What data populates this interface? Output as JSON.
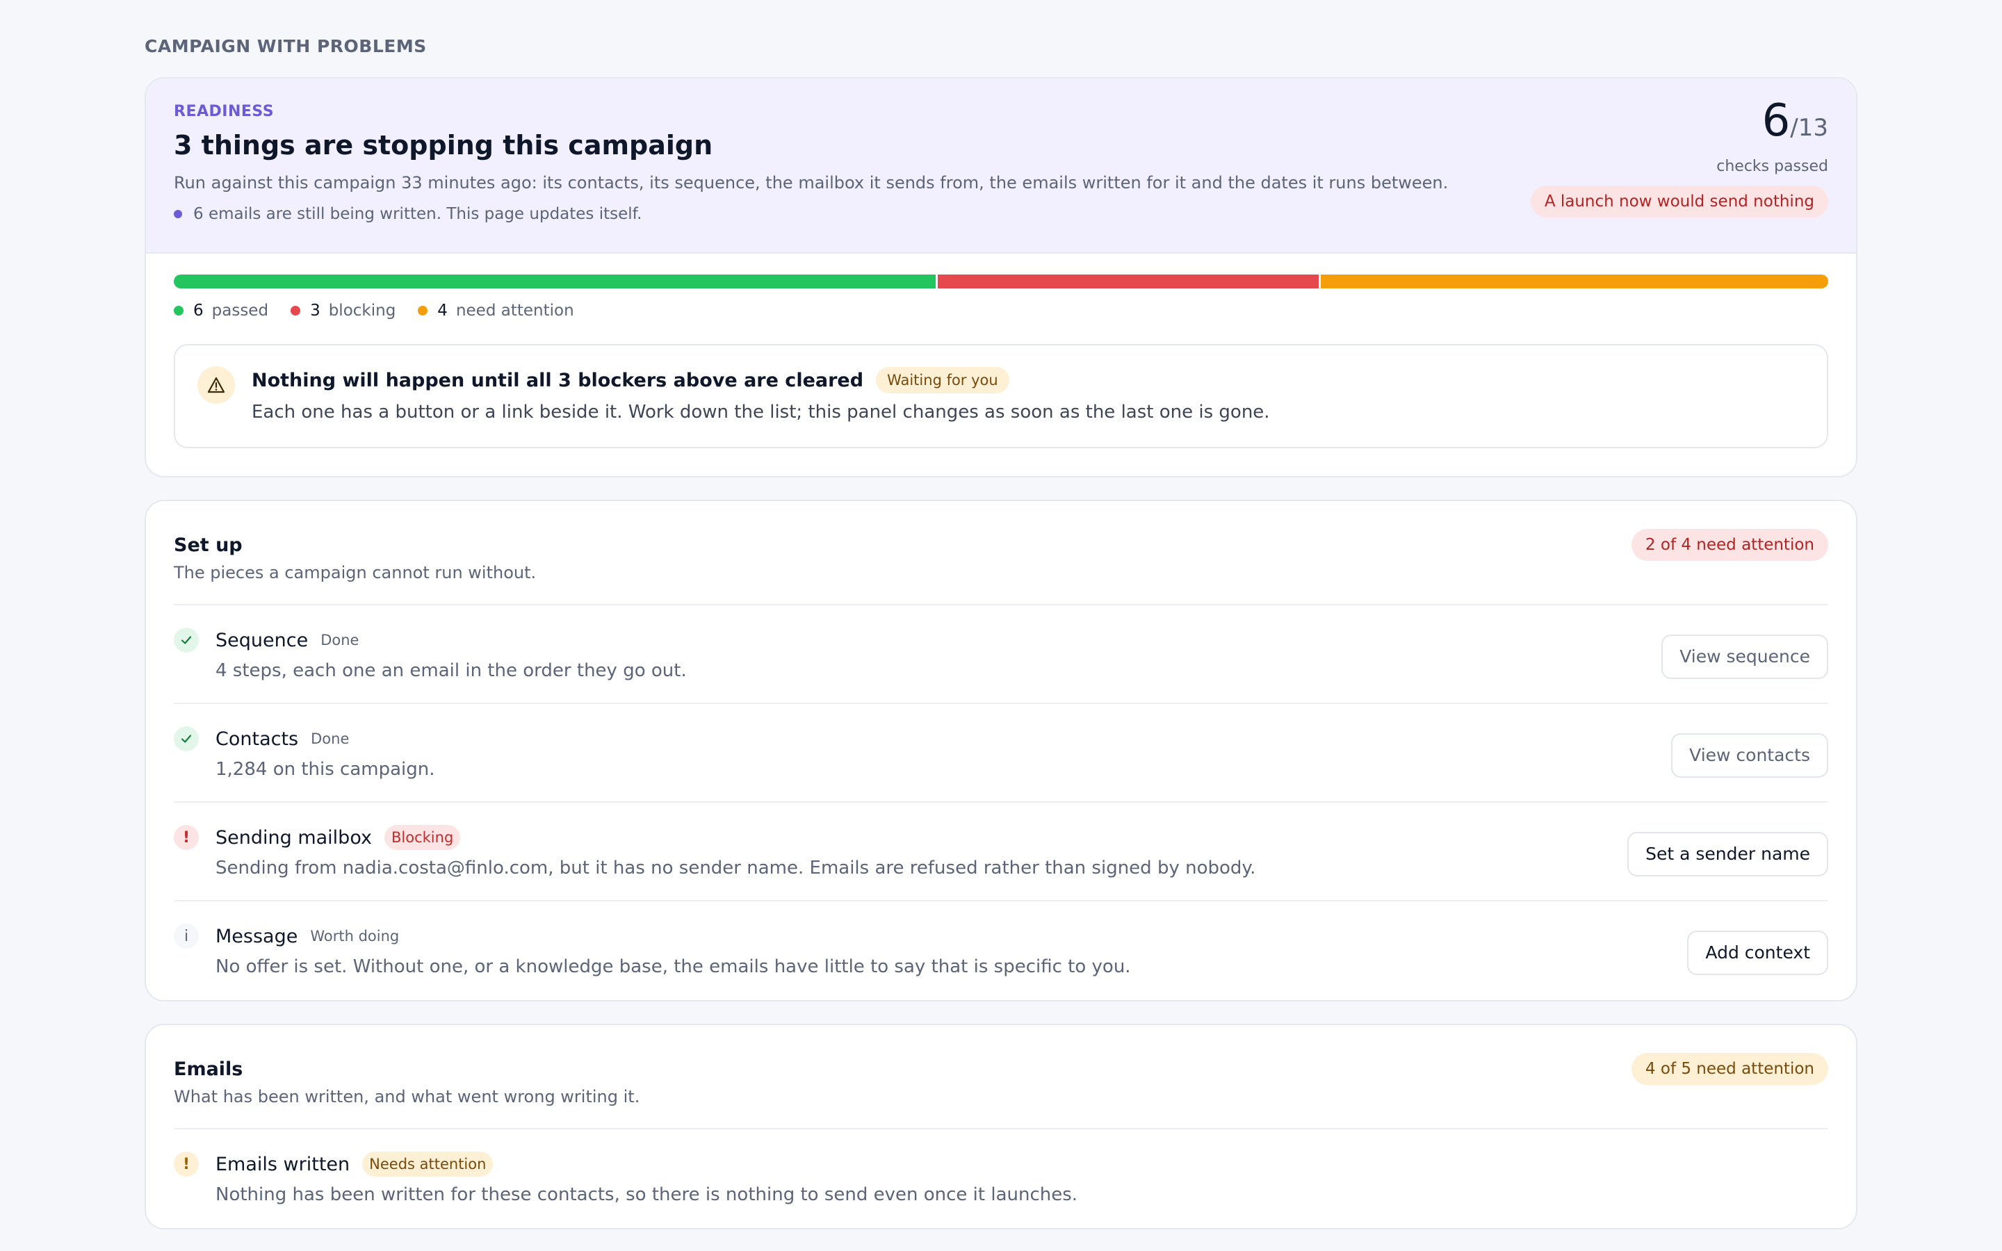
{
  "page_title": "CAMPAIGN WITH PROBLEMS",
  "readiness": {
    "eyebrow": "READINESS",
    "headline": "3 things are stopping this campaign",
    "subtext": "Run against this campaign 33 minutes ago: its contacts, its sequence, the mailbox it sends from, the emails written for it and the dates it runs between.",
    "updating": "6 emails are still being written. This page updates itself.",
    "score": {
      "passed": "6",
      "total": "/13",
      "caption": "checks passed"
    },
    "launch_warning": "A launch now would send nothing",
    "progress": {
      "passed": 6,
      "blocking": 3,
      "attention": 4,
      "total": 13
    },
    "legend": [
      {
        "num": "6",
        "label": "passed",
        "color": "#22c55e"
      },
      {
        "num": "3",
        "label": "blocking",
        "color": "#e5484d"
      },
      {
        "num": "4",
        "label": "need attention",
        "color": "#f59e0b"
      }
    ],
    "notice": {
      "title": "Nothing will happen until all 3 blockers above are cleared",
      "badge": "Waiting for you",
      "text": "Each one has a button or a link beside it. Work down the list; this panel changes as soon as the last one is gone."
    }
  },
  "setup": {
    "title": "Set up",
    "subtitle": "The pieces a campaign cannot run without.",
    "badge": "2 of 4 need attention",
    "rows": [
      {
        "title": "Sequence",
        "tag": "Done",
        "desc": "4 steps, each one an email in the order they go out.",
        "button": "View sequence"
      },
      {
        "title": "Contacts",
        "tag": "Done",
        "desc": "1,284 on this campaign.",
        "button": "View contacts"
      },
      {
        "title": "Sending mailbox",
        "tag": "Blocking",
        "desc": "Sending from nadia.costa@finlo.com, but it has no sender name. Emails are refused rather than signed by nobody.",
        "button": "Set a sender name"
      },
      {
        "title": "Message",
        "tag": "Worth doing",
        "desc": "No offer is set. Without one, or a knowledge base, the emails have little to say that is specific to you.",
        "button": "Add context"
      }
    ]
  },
  "emails": {
    "title": "Emails",
    "subtitle": "What has been written, and what went wrong writing it.",
    "badge": "4 of 5 need attention",
    "rows": [
      {
        "title": "Emails written",
        "tag": "Needs attention",
        "desc": "Nothing has been written for these contacts, so there is nothing to send even once it launches."
      }
    ]
  },
  "icons": {
    "check": "check-icon",
    "exclamation": "exclamation-icon",
    "info": "info-icon",
    "warning": "warning-triangle-icon"
  }
}
